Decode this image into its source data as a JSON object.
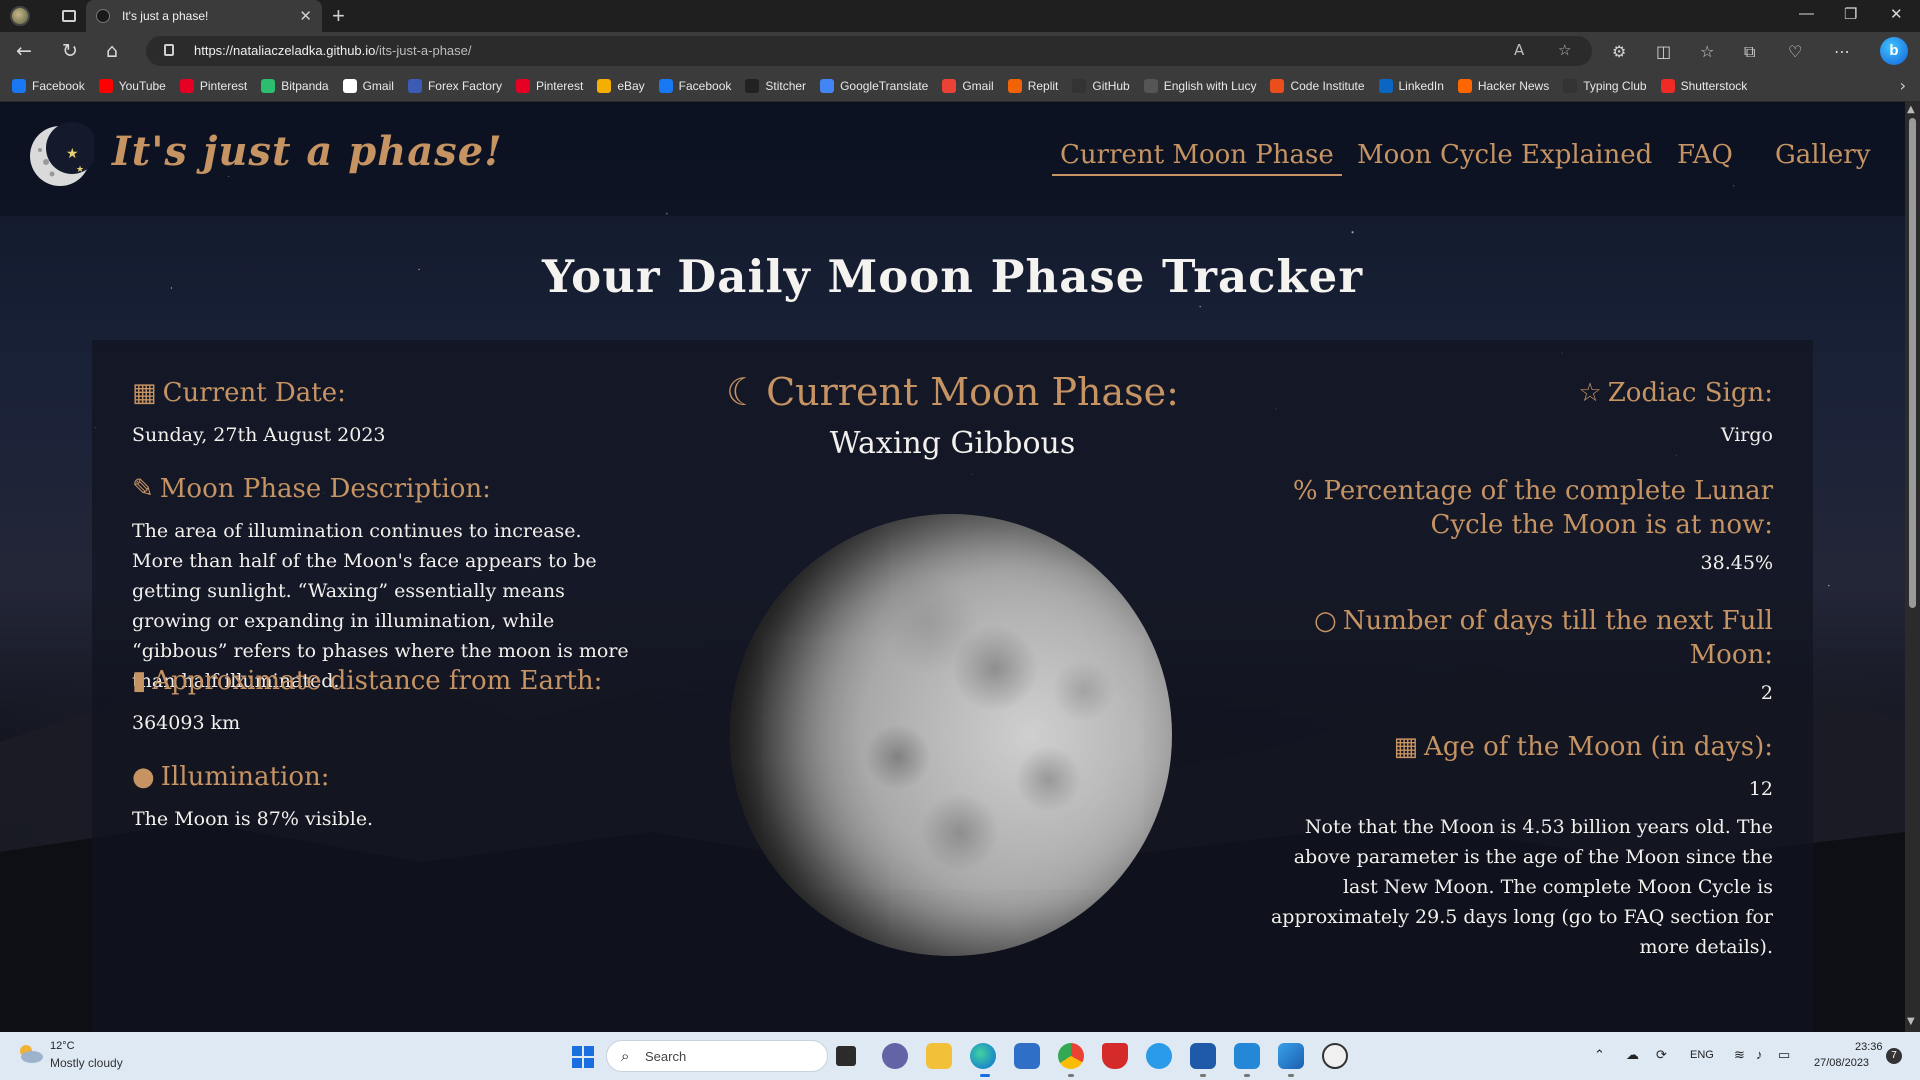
{
  "browser": {
    "tab_title": "It's just a phase!",
    "url_domain": "https://nataliaczeladka.github.io",
    "url_path": "/its-just-a-phase/",
    "bookmarks": [
      {
        "label": "Facebook",
        "color": "#1877f2",
        "icon": "facebook-icon"
      },
      {
        "label": "YouTube",
        "color": "#ff0000",
        "icon": "youtube-icon"
      },
      {
        "label": "Pinterest",
        "color": "#e60023",
        "icon": "pinterest-icon"
      },
      {
        "label": "Bitpanda",
        "color": "#2dbd6e",
        "icon": "bitpanda-icon"
      },
      {
        "label": "Gmail",
        "color": "#ffffff",
        "icon": "google-icon"
      },
      {
        "label": "Forex Factory",
        "color": "#3b5bb5",
        "icon": "forexfactory-icon"
      },
      {
        "label": "Pinterest",
        "color": "#e60023",
        "icon": "pinterest-icon"
      },
      {
        "label": "eBay",
        "color": "#f5af02",
        "icon": "ebay-icon"
      },
      {
        "label": "Facebook",
        "color": "#1877f2",
        "icon": "facebook-icon"
      },
      {
        "label": "Stitcher",
        "color": "#222222",
        "icon": "stitcher-icon"
      },
      {
        "label": "GoogleTranslate",
        "color": "#4285f4",
        "icon": "translate-icon"
      },
      {
        "label": "Gmail",
        "color": "#ea4335",
        "icon": "gmail-icon"
      },
      {
        "label": "Replit",
        "color": "#f26207",
        "icon": "replit-icon"
      },
      {
        "label": "GitHub",
        "color": "#333333",
        "icon": "github-icon"
      },
      {
        "label": "English with Lucy",
        "color": "#555555",
        "icon": "lucy-icon"
      },
      {
        "label": "Code Institute",
        "color": "#e94e1b",
        "icon": "codeinstitute-icon"
      },
      {
        "label": "LinkedIn",
        "color": "#0a66c2",
        "icon": "linkedin-icon"
      },
      {
        "label": "Hacker News",
        "color": "#ff6600",
        "icon": "hackernews-icon"
      },
      {
        "label": "Typing Club",
        "color": "#333333",
        "icon": "typingclub-icon"
      },
      {
        "label": "Shutterstock",
        "color": "#ee2b24",
        "icon": "shutterstock-icon"
      }
    ]
  },
  "site": {
    "brand": "It's just a phase!",
    "nav": [
      "Current Moon Phase",
      "Moon Cycle Explained",
      "FAQ",
      "Gallery"
    ],
    "page_title": "Your Daily Moon Phase Tracker",
    "accent_color": "#c69363"
  },
  "tracker": {
    "date_heading": "Current Date:",
    "date_value": "Sunday, 27th August 2023",
    "description_heading": "Moon Phase Description:",
    "description_text": "The area of illumination continues to increase. More than half of the Moon's face appears to be getting sunlight. “Waxing” essentially means growing or expanding in illumination, while “gibbous” refers to phases where the moon is more than half illuminated.",
    "distance_heading": "Approximate distance from Earth:",
    "distance_value": "364093 km",
    "illumination_heading": "Illumination:",
    "illumination_value": "The Moon is 87% visible.",
    "phase_heading": "Current Moon Phase:",
    "phase_value": "Waxing Gibbous",
    "zodiac_heading": "Zodiac Sign:",
    "zodiac_value": "Virgo",
    "cycle_heading_1": "Percentage of the complete Lunar",
    "cycle_heading_2": "Cycle the Moon is at now:",
    "cycle_value": "38.45%",
    "fullmoon_heading_1": "Number of days till the next Full",
    "fullmoon_heading_2": "Moon:",
    "fullmoon_value": "2",
    "age_heading": "Age of the Moon (in days):",
    "age_value": "12",
    "age_note": "Note that the Moon is 4.53 billion years old. The above parameter is the age of the Moon since the last New Moon. The complete Moon Cycle is approximately 29.5 days long (go to FAQ section for more details)."
  },
  "taskbar": {
    "temperature": "12°C",
    "weather": "Mostly cloudy",
    "search_placeholder": "Search",
    "language": "ENG",
    "time": "23:36",
    "date": "27/08/2023",
    "notifications": "7"
  }
}
